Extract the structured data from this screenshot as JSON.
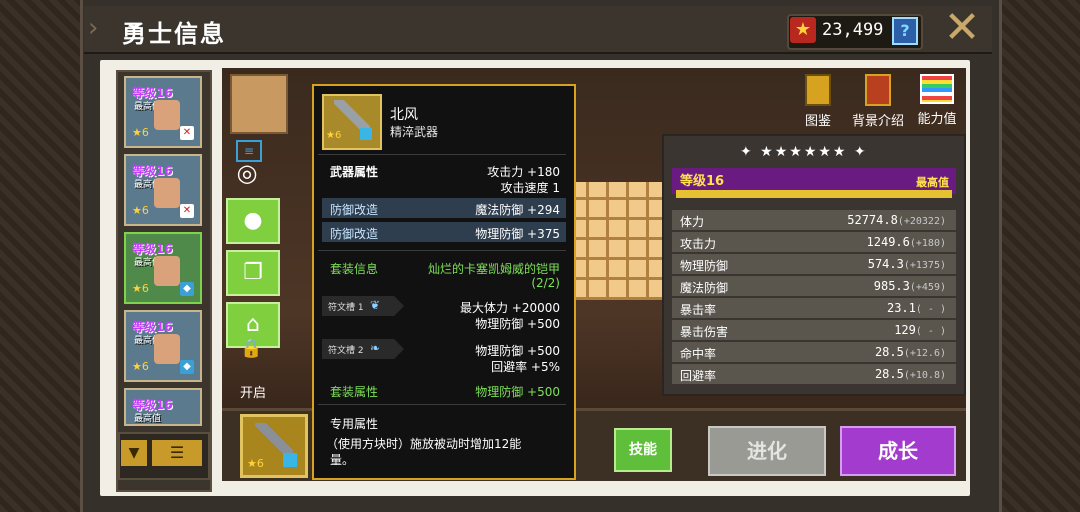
{
  "header": {
    "title": "勇士信息",
    "currency": "23,499",
    "help": "?"
  },
  "heroes": [
    {
      "level": "等级16",
      "max": "最高值",
      "star": "★6"
    },
    {
      "level": "等级16",
      "max": "最高值",
      "star": "★6"
    },
    {
      "level": "等级16",
      "max": "最高值",
      "star": "★6"
    },
    {
      "level": "等级16",
      "max": "最高值",
      "star": "★6"
    },
    {
      "level": "等级16",
      "max": "最高值",
      "star": ""
    }
  ],
  "side": {
    "unlock": "开启"
  },
  "top_icons": {
    "codex": "图鉴",
    "background": "背景介绍",
    "stats": "能力值"
  },
  "stats": {
    "stars": "✦ ★★★★★★ ✦",
    "level": "等级16",
    "level_max": "最高值",
    "level_progress": 1.0,
    "rows": [
      {
        "name": "体力",
        "value": "52774.8",
        "bonus": "(+20322)"
      },
      {
        "name": "攻击力",
        "value": "1249.6",
        "bonus": "(+180)"
      },
      {
        "name": "物理防御",
        "value": "574.3",
        "bonus": "(+1375)"
      },
      {
        "name": "魔法防御",
        "value": "985.3",
        "bonus": "(+459)"
      },
      {
        "name": "暴击率",
        "value": "23.1",
        "bonus": "( - )"
      },
      {
        "name": "暴击伤害",
        "value": "129",
        "bonus": "( - )"
      },
      {
        "name": "命中率",
        "value": "28.5",
        "bonus": "(+12.6)"
      },
      {
        "name": "回避率",
        "value": "28.5",
        "bonus": "(+10.8)"
      }
    ]
  },
  "buttons": {
    "skill": "技能",
    "evolve": "进化",
    "grow": "成长"
  },
  "tooltip": {
    "name": "北风",
    "type": "精淬武器",
    "star": "★6",
    "weapon_attr_label": "武器属性",
    "weapon_attr_1": "攻击力 +180",
    "weapon_attr_2": "攻击速度 1",
    "def_mod_label_1": "防御改造",
    "def_mod_value_1": "魔法防御 +294",
    "def_mod_label_2": "防御改造",
    "def_mod_value_2": "物理防御 +375",
    "set_info_label": "套装信息",
    "set_name": "灿烂的卡塞凯姆威的铠甲",
    "set_count": "(2/2)",
    "rune_1_label": "符文槽 1",
    "rune_1_line1": "最大体力 +20000",
    "rune_1_line2": "物理防御 +500",
    "rune_2_label": "符文槽 2",
    "rune_2_line1": "物理防御 +500",
    "rune_2_line2": "回避率 +5%",
    "set_attr_label": "套装属性",
    "set_attr_value": "物理防御 +500",
    "exclusive_label": "专用属性",
    "exclusive_text_1": "（使用方块时）施放被动时增加12能",
    "exclusive_text_2": "量。"
  }
}
